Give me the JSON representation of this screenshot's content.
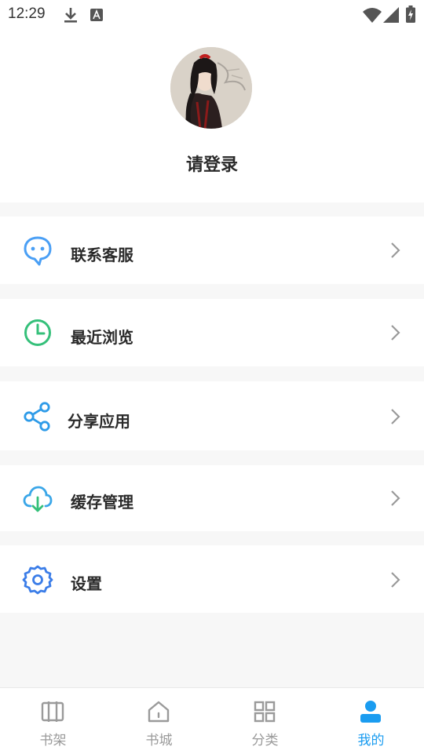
{
  "status_bar": {
    "time": "12:29",
    "icons": [
      "download-icon",
      "a-notification-icon",
      "wifi-icon",
      "cell-signal-icon",
      "battery-charging-icon"
    ]
  },
  "profile": {
    "login_label": "请登录",
    "avatar": "avatar-illustration"
  },
  "menu": {
    "items": [
      {
        "label": "联系客服",
        "icon": "chat-bubble-icon",
        "color": "#4a9ff5"
      },
      {
        "label": "最近浏览",
        "icon": "clock-icon",
        "color": "#35c07a"
      },
      {
        "label": "分享应用",
        "icon": "share-icon",
        "color": "#2e9be8"
      },
      {
        "label": "缓存管理",
        "icon": "cloud-download-icon",
        "color": "#3aa6e8"
      },
      {
        "label": "设置",
        "icon": "gear-icon",
        "color": "#3b7de8"
      }
    ]
  },
  "tabbar": {
    "tabs": [
      {
        "label": "书架",
        "icon": "bookshelf-icon"
      },
      {
        "label": "书城",
        "icon": "home-icon"
      },
      {
        "label": "分类",
        "icon": "category-grid-icon"
      },
      {
        "label": "我的",
        "icon": "person-icon",
        "active": true
      }
    ],
    "active_color": "#1a9cf0",
    "inactive_color": "#9a9a9a"
  }
}
